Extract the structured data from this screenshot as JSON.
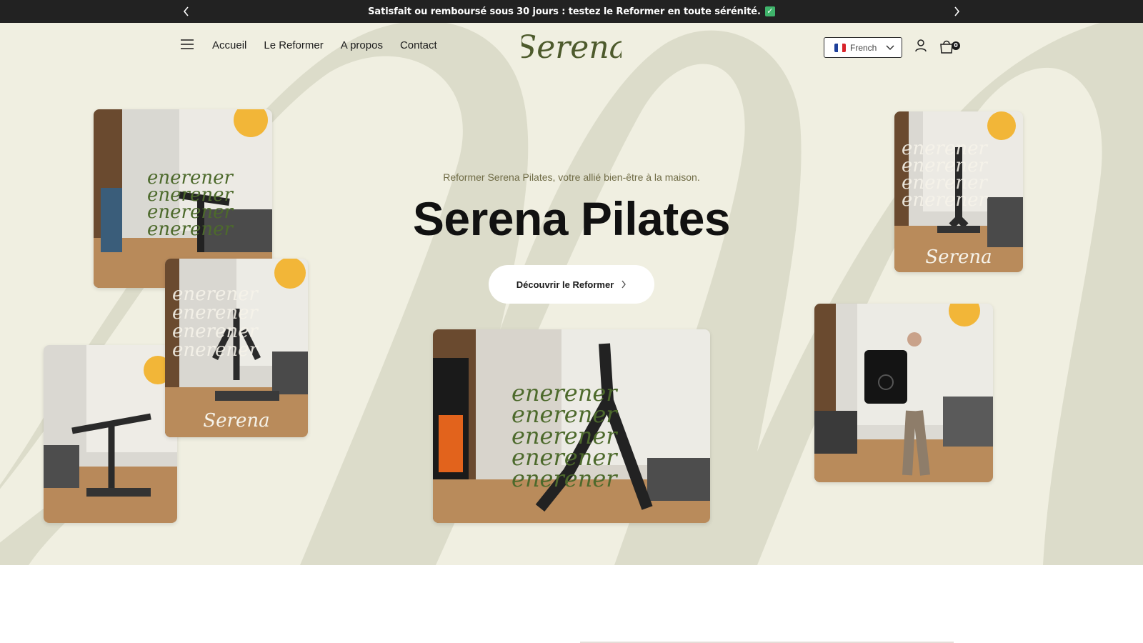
{
  "announcement": {
    "text": "Satisfait ou remboursé sous 30 jours : testez le Reformer en toute sérénité.",
    "check_icon": "check-badge-icon",
    "check_color": "#3fb46b"
  },
  "header": {
    "logo_text": "Serena",
    "nav": [
      "Accueil",
      "Le Reformer",
      "A propos",
      "Contact"
    ],
    "language": {
      "selected": "French",
      "flag_icon": "flag-fr-icon"
    },
    "cart_count": "0"
  },
  "hero": {
    "tagline": "Reformer Serena Pilates, votre allié bien-être à la maison.",
    "title": "Serena Pilates",
    "cta_label": "Découvrir le Reformer",
    "photo_watermark": "Serena"
  },
  "colors": {
    "announce_bg": "#222222",
    "hero_bg": "#f0efe1",
    "hero_swirl": "#dcdcca",
    "logo_green": "#4d5a2c",
    "tagline": "#6f6b45"
  }
}
